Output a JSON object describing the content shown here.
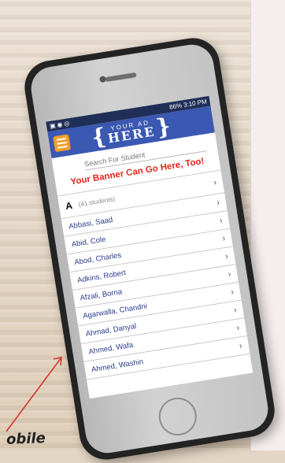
{
  "status_bar": {
    "battery": "86%",
    "time": "3:10 PM"
  },
  "ad_logo": {
    "small": "YOUR AD",
    "big": "HERE"
  },
  "search": {
    "placeholder": "Search For Student"
  },
  "banner": {
    "text": "Your Banner Can Go Here, Too!"
  },
  "list": {
    "section_letter": "A",
    "count_text": "(41 students)",
    "students": [
      "Abbasi, Saad",
      "Abid, Cole",
      "Abod, Charles",
      "Adkins, Robert",
      "Afzali, Borna",
      "Agarwalla, Chandni",
      "Ahmad, Danyal",
      "Ahmed, Wafa",
      "Ahmed, Washin"
    ]
  },
  "caption": {
    "text": "obile"
  },
  "colors": {
    "app_bar": "#3b58b2",
    "menu_button": "#f3a028",
    "banner_text": "#e1261c",
    "arrow": "#d8342a"
  }
}
